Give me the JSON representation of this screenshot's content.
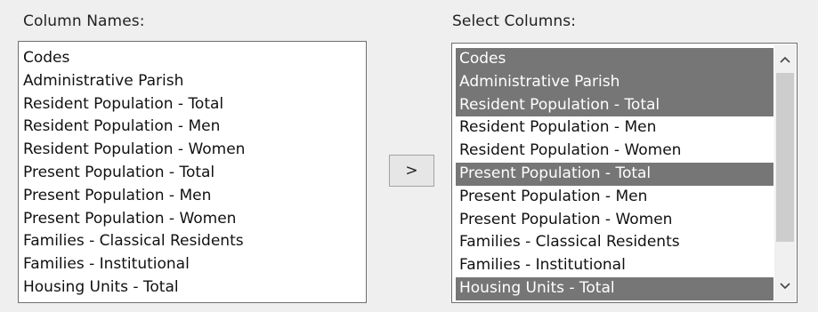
{
  "labels": {
    "column_names": "Column Names:",
    "select_columns": "Select Columns:"
  },
  "add_button": ">",
  "column_names": [
    "Codes",
    "Administrative Parish",
    "Resident Population - Total",
    "Resident Population - Men",
    "Resident Population - Women",
    "Present Population - Total",
    "Present Population - Men",
    "Present Population - Women",
    "Families - Classical Residents",
    "Families - Institutional",
    "Housing Units - Total"
  ],
  "select_columns": [
    {
      "label": "Codes",
      "selected": true
    },
    {
      "label": "Administrative Parish",
      "selected": true
    },
    {
      "label": "Resident Population - Total",
      "selected": true
    },
    {
      "label": "Resident Population - Men",
      "selected": false
    },
    {
      "label": "Resident Population - Women",
      "selected": false
    },
    {
      "label": "Present Population - Total",
      "selected": true
    },
    {
      "label": "Present Population - Men",
      "selected": false
    },
    {
      "label": "Present Population - Women",
      "selected": false
    },
    {
      "label": "Families - Classical Residents",
      "selected": false
    },
    {
      "label": "Families - Institutional",
      "selected": false
    },
    {
      "label": "Housing Units - Total",
      "selected": true
    }
  ],
  "colors": {
    "selection": "#767676",
    "background": "#efefef"
  }
}
